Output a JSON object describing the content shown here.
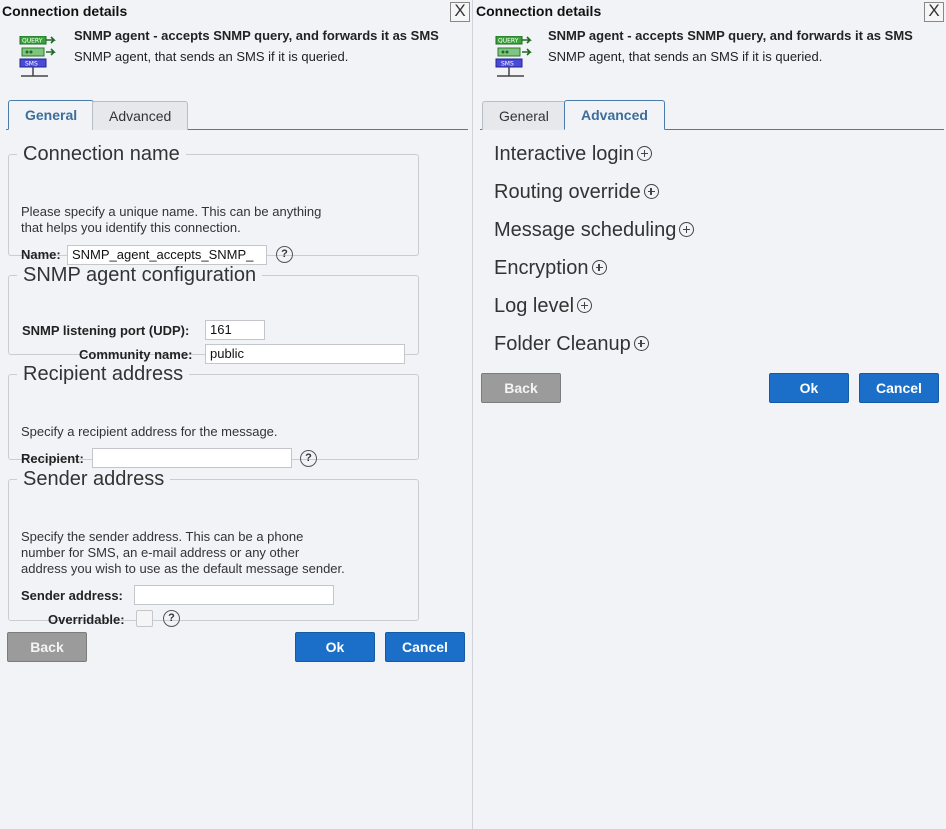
{
  "left": {
    "window_title": "Connection details",
    "close_label": "X",
    "header": {
      "title": "SNMP agent - accepts SNMP query, and forwards it as SMS",
      "description": "SNMP agent, that sends an SMS if it is queried."
    },
    "tabs": [
      {
        "label": "General",
        "active": true
      },
      {
        "label": "Advanced",
        "active": false
      }
    ],
    "connection_name": {
      "legend": "Connection name",
      "help_line1": "Please specify a unique name. This can be anything",
      "help_line2": "that helps you identify this connection.",
      "name_label": "Name:",
      "name_value": "SNMP_agent_accepts_SNMP_"
    },
    "snmp_config": {
      "legend": "SNMP agent configuration",
      "port_label": "SNMP listening port (UDP):",
      "port_value": "161",
      "community_label": "Community name:",
      "community_value": "public"
    },
    "recipient": {
      "legend": "Recipient address",
      "help": "Specify a recipient address for the message.",
      "label": "Recipient:",
      "value": ""
    },
    "sender": {
      "legend": "Sender address",
      "help_line1": "Specify the sender address. This can be a phone",
      "help_line2": "number for SMS, an e-mail address or any other",
      "help_line3": "address you wish to use as the default message sender.",
      "label": "Sender address:",
      "value": "",
      "overridable_label": "Overridable:",
      "overridable_checked": false
    },
    "help_glyph": "?",
    "buttons": {
      "back": "Back",
      "ok": "Ok",
      "cancel": "Cancel"
    }
  },
  "right": {
    "window_title": "Connection details",
    "close_label": "X",
    "header": {
      "title": "SNMP agent - accepts SNMP query, and forwards it as SMS",
      "description": "SNMP agent, that sends an SMS if it is queried."
    },
    "tabs": [
      {
        "label": "General",
        "active": false
      },
      {
        "label": "Advanced",
        "active": true
      }
    ],
    "sections": [
      "Interactive login",
      "Routing override",
      "Message scheduling",
      "Encryption",
      "Log level",
      "Folder Cleanup"
    ],
    "buttons": {
      "back": "Back",
      "ok": "Ok",
      "cancel": "Cancel"
    }
  },
  "icon_labels": {
    "query": "QUERY",
    "sms": "SMS"
  },
  "colors": {
    "accent": "#1b6fc8",
    "tab_active": "#3d6e9b",
    "back_button": "#9b9b9b"
  }
}
